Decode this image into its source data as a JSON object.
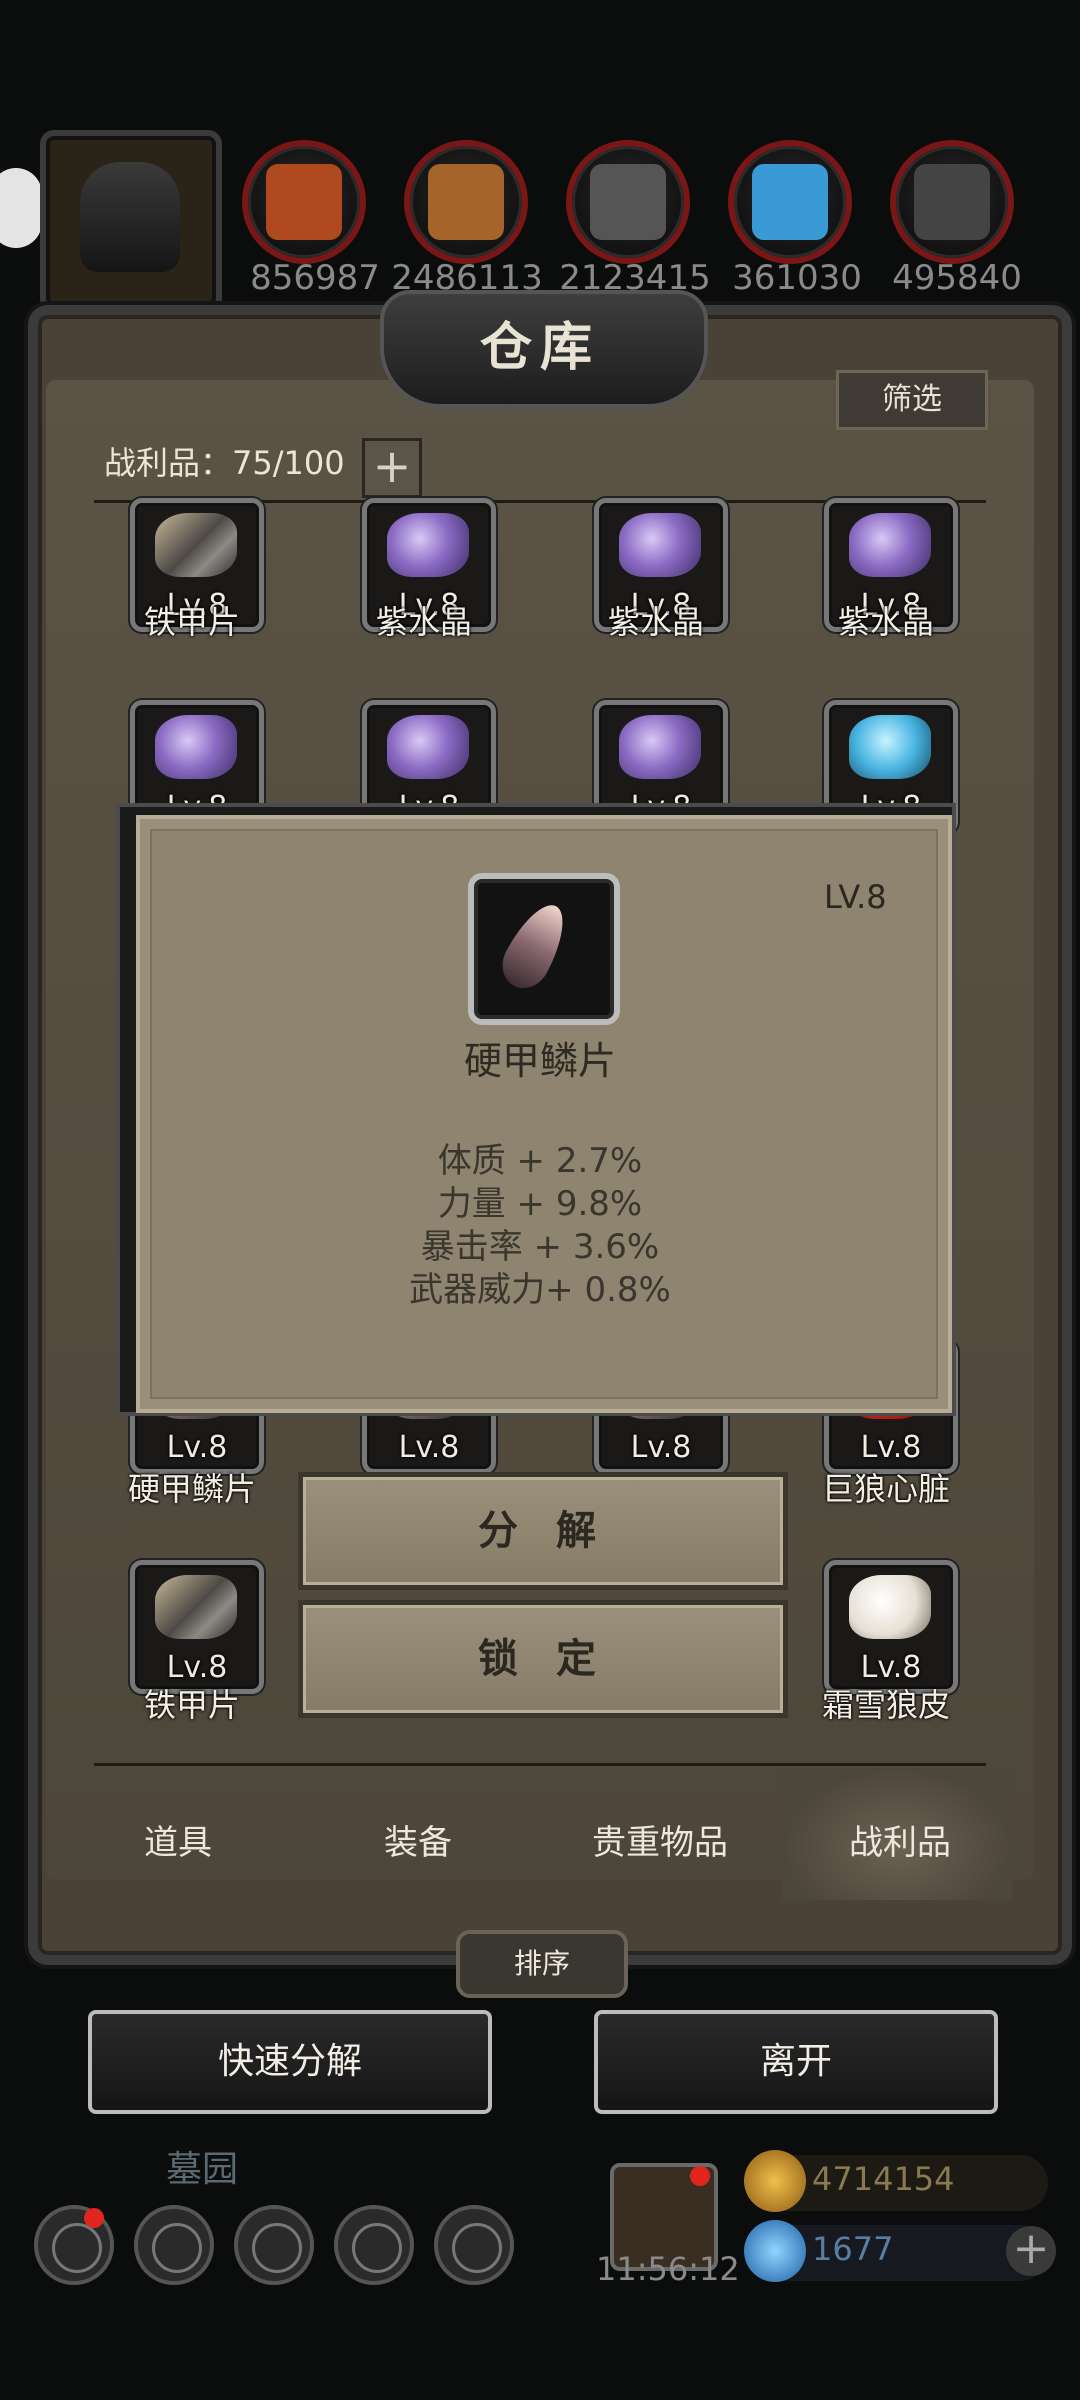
{
  "top_resources": [
    {
      "icon": "meat-icon",
      "value": "856987",
      "color": "#b04a1e"
    },
    {
      "icon": "wood-icon",
      "value": "2486113",
      "color": "#a5652a"
    },
    {
      "icon": "stone-icon",
      "value": "2123415",
      "color": "#555555"
    },
    {
      "icon": "crystal-icon",
      "value": "361030",
      "color": "#3a9ad6"
    },
    {
      "icon": "iron-icon",
      "value": "495840",
      "color": "#444444"
    }
  ],
  "warehouse": {
    "title": "仓库",
    "filter_label": "筛选",
    "loot_count": "战利品：75/100",
    "plus_label": "+"
  },
  "grid": {
    "row1": [
      {
        "name": "铁甲片",
        "lv": "Lv.8",
        "kind": "iron"
      },
      {
        "name": "紫水晶",
        "lv": "Lv.8",
        "kind": "purple"
      },
      {
        "name": "紫水晶",
        "lv": "Lv.8",
        "kind": "purple"
      },
      {
        "name": "紫水晶",
        "lv": "Lv.8",
        "kind": "purple"
      }
    ],
    "row2": [
      {
        "lv": "Lv.8",
        "kind": "purple"
      },
      {
        "lv": "Lv.8",
        "kind": "purple"
      },
      {
        "lv": "Lv.8",
        "kind": "purple"
      },
      {
        "lv": "Lv.8",
        "kind": "ice"
      }
    ],
    "row3": [
      {
        "name": "硬甲鳞片",
        "lv": "Lv.8"
      },
      {
        "lv": "Lv.8"
      },
      {
        "lv": "Lv.8"
      },
      {
        "name": "巨狼心脏",
        "lv": "Lv.8"
      }
    ],
    "row4": [
      {
        "name": "铁甲片",
        "lv": "Lv.8"
      },
      {
        "name": "霜雪狼皮",
        "lv": "Lv.8"
      }
    ]
  },
  "popup": {
    "lv": "LV.8",
    "item_name": "硬甲鳞片",
    "stats": [
      "体质 + 2.7%",
      "力量 + 9.8%",
      "暴击率 + 3.6%",
      "武器威力+ 0.8%"
    ],
    "decompose_label": "分 解",
    "lock_label": "锁 定"
  },
  "tabs": [
    "道具",
    "装备",
    "贵重物品",
    "战利品"
  ],
  "active_tab": "战利品",
  "sort_label": "排序",
  "quick_decompose_label": "快速分解",
  "leave_label": "离开",
  "hud": {
    "location": "墓园",
    "timer": "11:56:12",
    "gold": "4714154",
    "gems": "1677"
  }
}
